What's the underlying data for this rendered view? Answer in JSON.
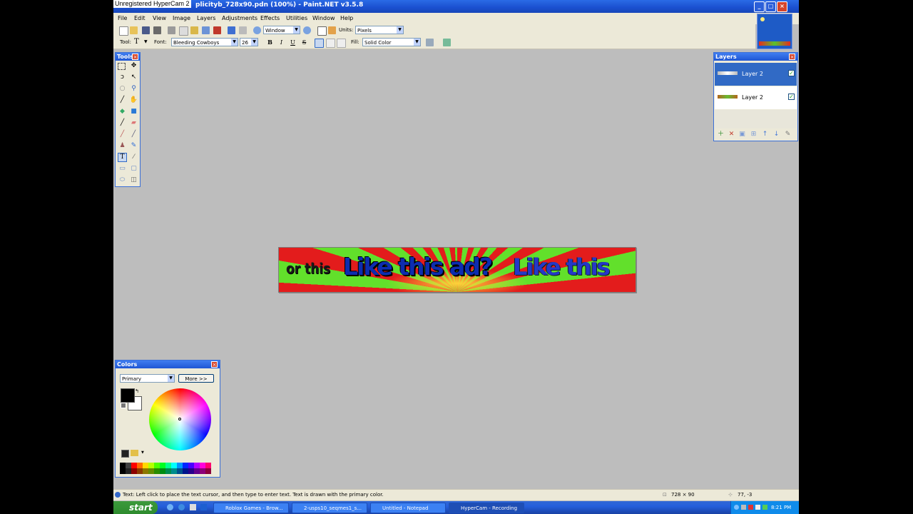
{
  "recorder_watermark": "Unregistered HyperCam 2",
  "window": {
    "title": "plicityb_728x90.pdn (100%) - Paint.NET v3.5.8",
    "min": "_",
    "max": "□",
    "close": "×"
  },
  "menu": [
    "File",
    "Edit",
    "View",
    "Image",
    "Layers",
    "Adjustments",
    "Effects",
    "Utilities",
    "Window",
    "Help"
  ],
  "toolbar1": {
    "zoom_combo": "Window",
    "units_label": "Units:",
    "units_combo": "Pixels"
  },
  "toolbar2": {
    "tool_label": "Tool:",
    "tool_glyph": "T",
    "font_label": "Font:",
    "font_combo": "Bleeding Cowboys",
    "size_combo": "26",
    "bold": "B",
    "italic": "I",
    "underline": "U",
    "strike": "S",
    "fill_label": "Fill:",
    "fill_combo": "Solid Color"
  },
  "tools_panel": {
    "title": "Tools",
    "close": "×"
  },
  "canvas": {
    "text_or_this": "or this",
    "text_main": "Like this ad?",
    "text_like": "Like this"
  },
  "layers_panel": {
    "title": "Layers",
    "close": "×",
    "layers": [
      {
        "name": "Layer 2",
        "visible": "✓"
      },
      {
        "name": "Layer 2",
        "visible": "✓"
      }
    ]
  },
  "colors_panel": {
    "title": "Colors",
    "close": "×",
    "mode_combo": "Primary",
    "more_button": "More >>",
    "primary_color": "#000000",
    "secondary_color": "#ffffff",
    "palette": [
      "#000000",
      "#404040",
      "#ff0000",
      "#ff6a00",
      "#ffd800",
      "#b6ff00",
      "#4cff00",
      "#00ff21",
      "#00ff90",
      "#00ffff",
      "#0094ff",
      "#0026ff",
      "#4800ff",
      "#b200ff",
      "#ff00dc",
      "#ff006e"
    ]
  },
  "status": {
    "hint": "Text: Left click to place the text cursor, and then type to enter text. Text is drawn with the primary color.",
    "image_size": "728 × 90",
    "cursor_pos": "77, -3"
  },
  "taskbar": {
    "start": "start",
    "buttons": [
      "Roblox Games - Brow...",
      "2-usps10_seqmes1_s...",
      "Untitled - Notepad",
      "HyperCam - Recording"
    ],
    "clock": "8:21 PM"
  }
}
